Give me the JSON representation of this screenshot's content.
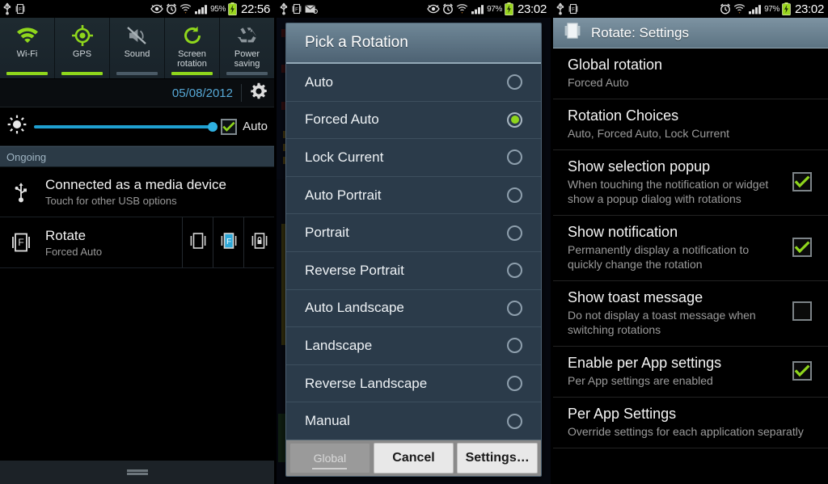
{
  "panel1": {
    "statusbar": {
      "left_icons": [
        "usb-icon",
        "rotate-app-icon"
      ],
      "right_icons": [
        "eye-icon",
        "alarm-icon",
        "wifi-sync-icon",
        "signal-icon"
      ],
      "battery_pct": "95%",
      "time": "22:56"
    },
    "toggles": [
      {
        "label": "Wi-Fi",
        "icon": "wifi-icon",
        "state": "on"
      },
      {
        "label": "GPS",
        "icon": "gps-icon",
        "state": "on"
      },
      {
        "label": "Sound",
        "icon": "sound-muted-icon",
        "state": "off"
      },
      {
        "label": "Screen\nrotation",
        "label_line1": "Screen",
        "label_line2": "rotation",
        "icon": "screen-rotation-icon",
        "state": "on"
      },
      {
        "label": "Power\nsaving",
        "label_line1": "Power",
        "label_line2": "saving",
        "icon": "power-saving-icon",
        "state": "off"
      }
    ],
    "datebar": {
      "date": "05/08/2012",
      "settings_icon": "gear-icon"
    },
    "brightness": {
      "icon": "brightness-icon",
      "auto_label": "Auto",
      "auto_checked": true,
      "slider_value": 100
    },
    "section_header": "Ongoing",
    "notifications": [
      {
        "icon": "usb-icon",
        "title": "Connected as a media device",
        "subtitle": "Touch for other USB options"
      },
      {
        "icon": "rotate-app-icon",
        "title": "Rotate",
        "subtitle": "Forced Auto",
        "actions": [
          {
            "name": "auto-rotate-action",
            "icon": "rotate-auto-icon",
            "selected": false
          },
          {
            "name": "forced-auto-action",
            "icon": "rotate-forced-auto-icon",
            "selected": true
          },
          {
            "name": "lock-current-action",
            "icon": "rotate-lock-icon",
            "selected": false
          }
        ]
      }
    ],
    "handle": "shade-handle"
  },
  "panel2": {
    "statusbar": {
      "left_icons": [
        "usb-icon",
        "rotate-app-icon",
        "mail-icon"
      ],
      "right_icons": [
        "eye-icon",
        "alarm-icon",
        "wifi-sync-icon",
        "signal-icon"
      ],
      "battery_pct": "97%",
      "time": "23:02"
    },
    "dialog": {
      "title": "Pick a Rotation",
      "options": [
        {
          "label": "Auto",
          "selected": false
        },
        {
          "label": "Forced Auto",
          "selected": true
        },
        {
          "label": "Lock Current",
          "selected": false
        },
        {
          "label": "Auto Portrait",
          "selected": false
        },
        {
          "label": "Portrait",
          "selected": false
        },
        {
          "label": "Reverse Portrait",
          "selected": false
        },
        {
          "label": "Auto Landscape",
          "selected": false
        },
        {
          "label": "Landscape",
          "selected": false
        },
        {
          "label": "Reverse Landscape",
          "selected": false
        },
        {
          "label": "Manual",
          "selected": false
        }
      ],
      "buttons": [
        {
          "label": "Global",
          "state": "disabled"
        },
        {
          "label": "Cancel",
          "state": "enabled"
        },
        {
          "label": "Settings…",
          "state": "enabled"
        }
      ]
    }
  },
  "panel3": {
    "statusbar": {
      "left_icons": [
        "usb-icon",
        "rotate-app-icon"
      ],
      "right_icons": [
        "alarm-icon",
        "wifi-sync-icon",
        "signal-icon"
      ],
      "battery_pct": "97%",
      "time": "23:02"
    },
    "title": {
      "icon": "rotate-app-icon",
      "label": "Rotate: Settings"
    },
    "prefs": [
      {
        "title": "Global rotation",
        "summary": "Forced Auto",
        "has_checkbox": false,
        "checked": false
      },
      {
        "title": "Rotation Choices",
        "summary": "Auto, Forced Auto, Lock Current",
        "has_checkbox": false,
        "checked": false
      },
      {
        "title": "Show selection popup",
        "summary": "When touching the notification or widget show a popup dialog with rotations",
        "has_checkbox": true,
        "checked": true
      },
      {
        "title": "Show notification",
        "summary": "Permanently display a notification to quickly change the rotation",
        "has_checkbox": true,
        "checked": true
      },
      {
        "title": "Show toast message",
        "summary": "Do not display a toast message when switching rotations",
        "has_checkbox": true,
        "checked": false
      },
      {
        "title": "Enable per App settings",
        "summary": "Per App settings are enabled",
        "has_checkbox": true,
        "checked": true
      },
      {
        "title": "Per App Settings",
        "summary": "Override settings for each application separatly",
        "has_checkbox": false,
        "checked": false
      }
    ]
  },
  "colors": {
    "accent_green": "#8fd61c",
    "accent_blue": "#1f9fd0",
    "date_blue": "#56a8d6",
    "dialog_body": "#2b3b4a",
    "dialog_header": "#5d7someting"
  }
}
